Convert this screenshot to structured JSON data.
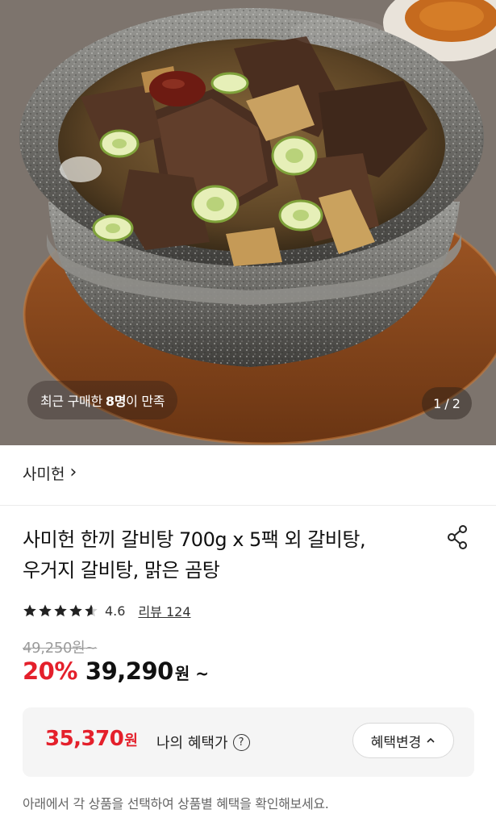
{
  "hero": {
    "badge_prefix": "최근 구매한",
    "badge_count": "8명",
    "badge_suffix": "이 만족",
    "counter_current": "1",
    "counter_sep": "/",
    "counter_total": "2"
  },
  "brand": {
    "name": "사미헌",
    "chevron": "›"
  },
  "product": {
    "title_line1": "사미헌 한끼 갈비탕 700g x 5팩 외 갈비탕,",
    "title_line2": "우거지 갈비탕, 맑은 곰탕",
    "share_icon": "share-icon"
  },
  "rating": {
    "stars": 4.6,
    "value": "4.6",
    "review_label": "리뷰 124"
  },
  "price": {
    "original": "49,250원~",
    "discount": "20%",
    "sale": "39,290",
    "sale_unit": "원 ~"
  },
  "benefit": {
    "price": "35,370",
    "unit": "원",
    "label": "나의 혜택가",
    "info": "?",
    "button_label": "혜택변경",
    "button_chevron": "^"
  },
  "notice": "아래에서 각 상품을 선택하여 상품별 혜택을 확인해보세요.",
  "colors": {
    "accent_red": "#e4202b",
    "benefit_bg": "#f5f5f5"
  }
}
